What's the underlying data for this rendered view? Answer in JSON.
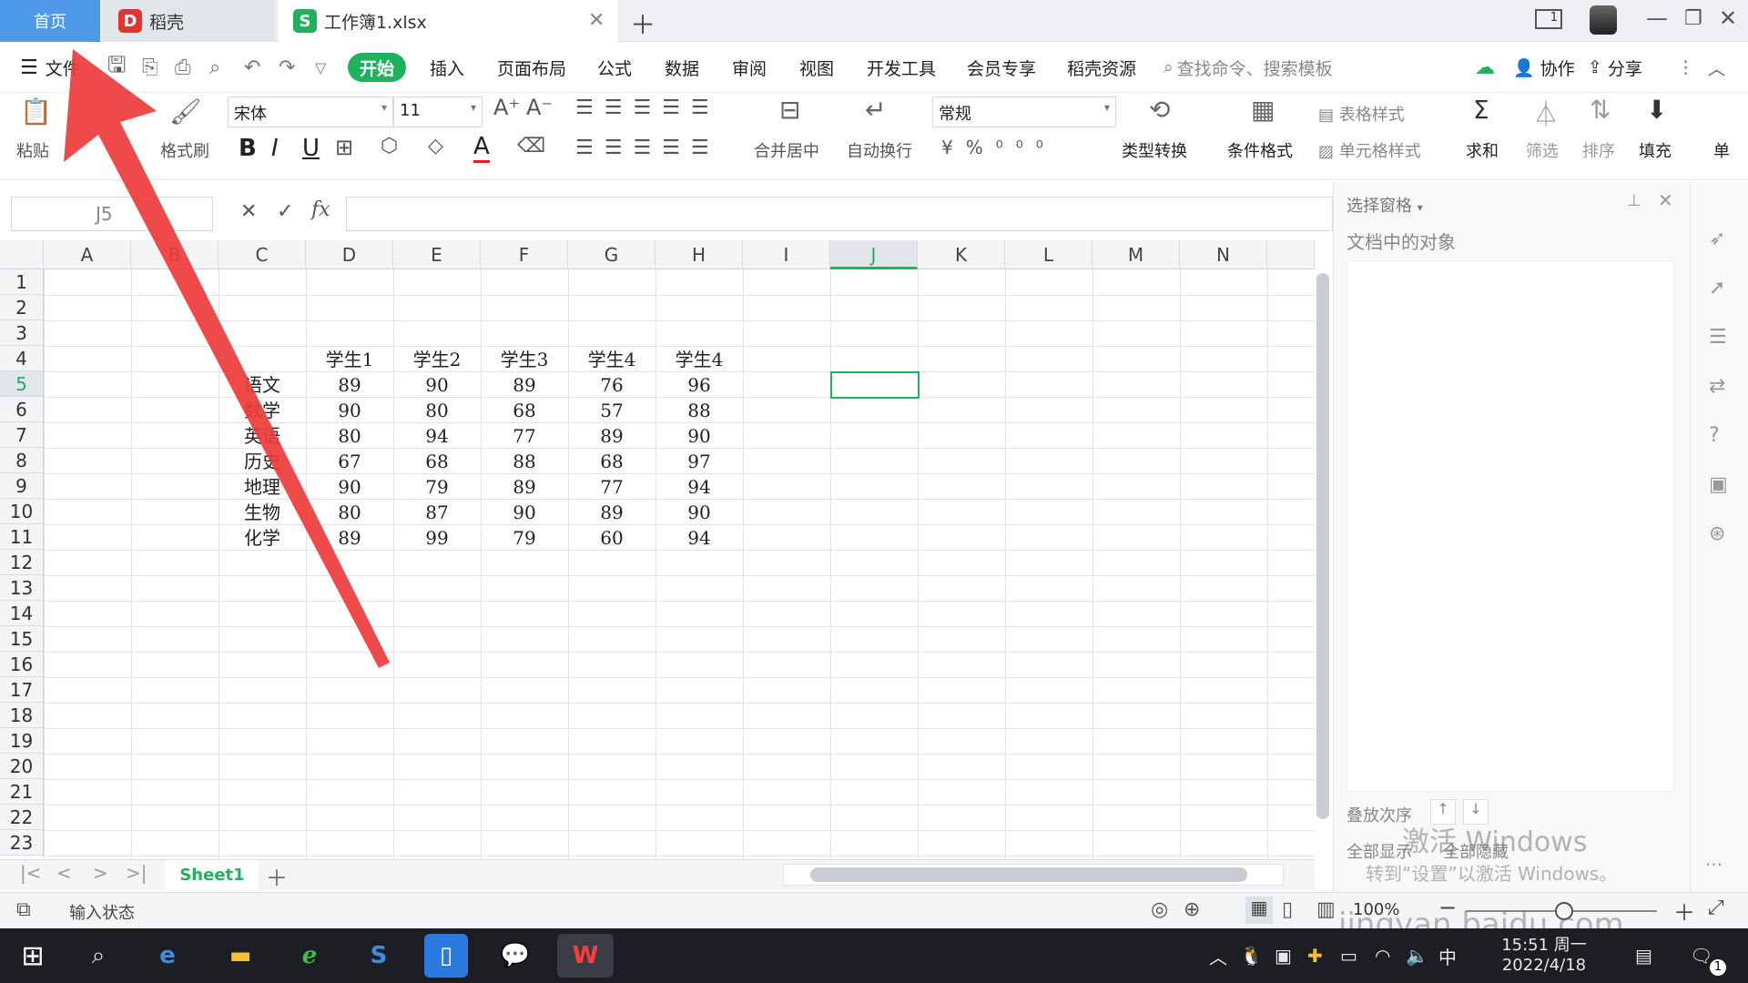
{
  "tabs": {
    "home": "首页",
    "daoke": "稻壳",
    "workbook": "工作簿1.xlsx"
  },
  "menu": {
    "file": "文件",
    "items": [
      "开始",
      "插入",
      "页面布局",
      "公式",
      "数据",
      "审阅",
      "视图",
      "开发工具",
      "会员专享",
      "稻壳资源"
    ],
    "search_placeholder": "查找命令、搜索模板",
    "collab": "协作",
    "share": "分享"
  },
  "ribbon": {
    "paste": "粘贴",
    "format_painter": "格式刷",
    "font": "宋体",
    "size": "11",
    "merge": "合并居中",
    "wrap": "自动换行",
    "number_format": "常规",
    "type_convert": "类型转换",
    "cond_format": "条件格式",
    "table_style": "表格样式",
    "cell_style": "单元格样式",
    "sum": "求和",
    "filter": "筛选",
    "sort": "排序",
    "fill": "填充",
    "single": "单"
  },
  "formula": {
    "cell_ref": "J5",
    "fx": "fx",
    "content": ""
  },
  "columns": [
    "A",
    "B",
    "C",
    "D",
    "E",
    "F",
    "G",
    "H",
    "I",
    "J",
    "K",
    "L",
    "M",
    "N"
  ],
  "rows": [
    "1",
    "2",
    "3",
    "4",
    "5",
    "6",
    "7",
    "8",
    "9",
    "10",
    "11",
    "12",
    "13",
    "14",
    "15",
    "16",
    "17",
    "18",
    "19",
    "20",
    "21",
    "22",
    "23"
  ],
  "table": {
    "headers": [
      "学生1",
      "学生2",
      "学生3",
      "学生4",
      "学生4"
    ],
    "subjects": [
      "语文",
      "数学",
      "英语",
      "历史",
      "地理",
      "生物",
      "化学"
    ],
    "values": [
      [
        "89",
        "90",
        "89",
        "76",
        "96"
      ],
      [
        "90",
        "80",
        "68",
        "57",
        "88"
      ],
      [
        "80",
        "94",
        "77",
        "89",
        "90"
      ],
      [
        "67",
        "68",
        "88",
        "68",
        "97"
      ],
      [
        "90",
        "79",
        "89",
        "77",
        "94"
      ],
      [
        "80",
        "87",
        "90",
        "89",
        "90"
      ],
      [
        "89",
        "99",
        "79",
        "60",
        "94"
      ]
    ]
  },
  "pane": {
    "title": "选择窗格",
    "objects": "文档中的对象",
    "stack_order": "叠放次序",
    "show_all": "全部显示",
    "hide_all": "全部隐藏"
  },
  "sheet": {
    "name": "Sheet1"
  },
  "status": {
    "input_state": "输入状态",
    "zoom": "100%"
  },
  "watermark": {
    "activate": "激活 Windows",
    "activate_sub": "转到“设置”以激活 Windows。",
    "site": "jingyan.baidu.com"
  },
  "clock": {
    "time": "15:51 周一",
    "date": "2022/4/18",
    "ime": "中",
    "notif": "1"
  },
  "colors": {
    "accent": "#1fb15e",
    "home_tab": "#4f9ae8",
    "arrow": "#ee3b3b",
    "taskbar": "#1c1e24"
  }
}
